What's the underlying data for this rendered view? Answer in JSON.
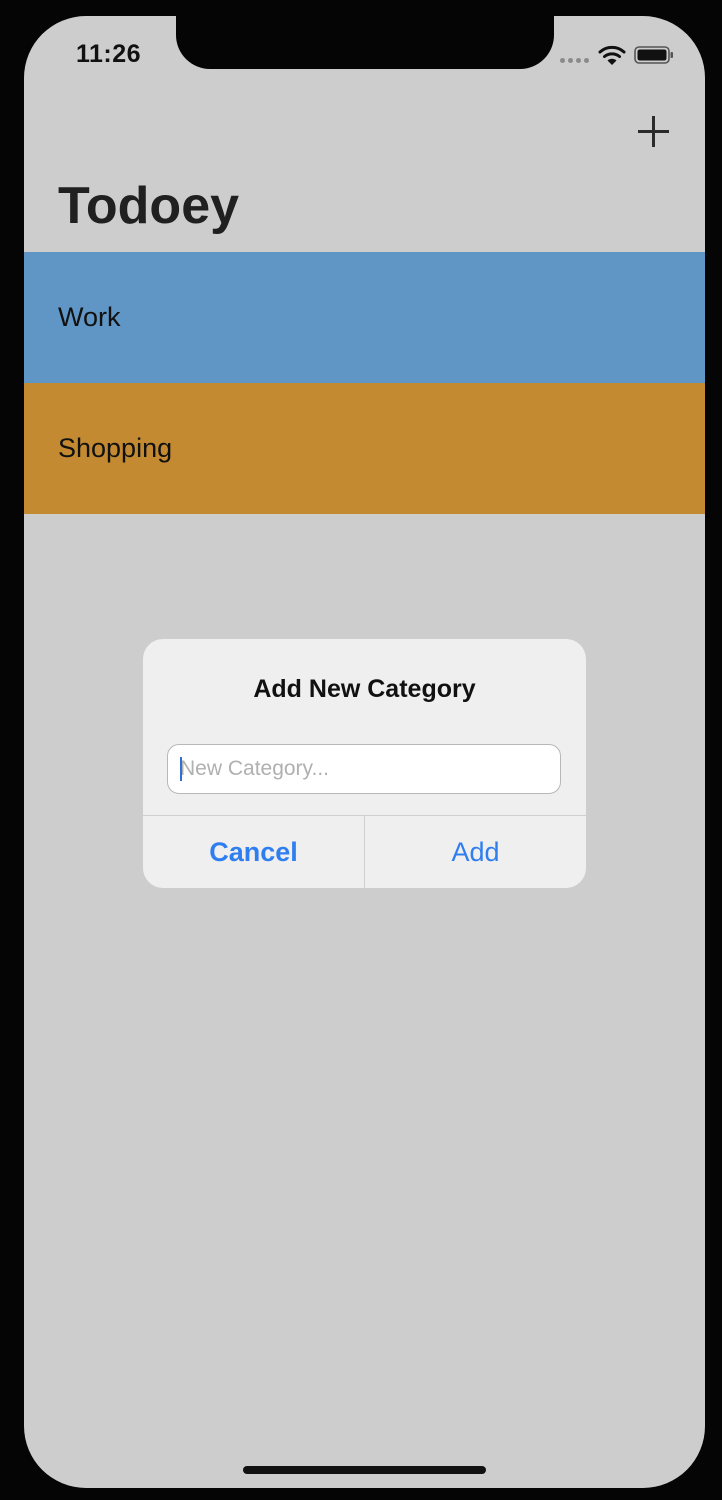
{
  "status_bar": {
    "time": "11:26",
    "signal_icon": "cellular-signal-icon",
    "wifi_icon": "wifi-icon",
    "battery_icon": "battery-icon"
  },
  "nav": {
    "title": "Todoey",
    "add_icon": "plus-icon"
  },
  "categories": [
    {
      "label": "Work",
      "color": "#6096c6"
    },
    {
      "label": "Shopping",
      "color": "#c48a31"
    }
  ],
  "alert": {
    "title": "Add New Category",
    "input_value": "",
    "input_placeholder": "New Category...",
    "cancel_label": "Cancel",
    "confirm_label": "Add",
    "accent_color": "#2f7ef0"
  },
  "colors": {
    "background": "#cdcdcd",
    "alert_background": "#efefef"
  }
}
